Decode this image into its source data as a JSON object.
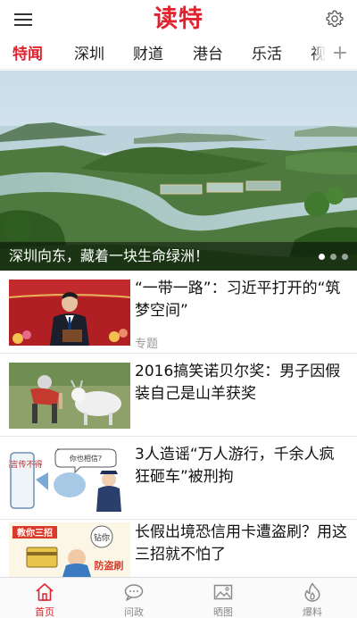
{
  "header": {
    "logo": "读特",
    "menu_icon": "menu-icon",
    "settings_icon": "gear-icon"
  },
  "tabs": [
    {
      "label": "特闻",
      "active": true
    },
    {
      "label": "深圳",
      "active": false
    },
    {
      "label": "财道",
      "active": false
    },
    {
      "label": "港台",
      "active": false
    },
    {
      "label": "乐活",
      "active": false
    },
    {
      "label": "视",
      "active": false
    }
  ],
  "tabs_add_label": "+",
  "hero": {
    "caption": "深圳向东，藏着一块生命绿洲！",
    "slide_count": 3,
    "active_slide": 1
  },
  "news": [
    {
      "title": "“一带一路”：习近平打开的“筑梦空间”",
      "tag": "专题"
    },
    {
      "title": "2016搞笑诺贝尔奖：男子因假装自己是山羊获奖",
      "tag": ""
    },
    {
      "title": "3人造谣“万人游行，千余人疯狂砸车”被刑拘",
      "tag": ""
    },
    {
      "title": "长假出境恐信用卡遭盗刷？用这三招就不怕了",
      "tag": ""
    }
  ],
  "thumb_texts": {
    "news3_bubble": "你也相信?",
    "news3_side": "谣言传不得",
    "news4_top": "教你三招",
    "news4_badge": "防盗刷",
    "news4_bubble": "钻你"
  },
  "bottom_nav": [
    {
      "label": "首页",
      "icon": "home-icon",
      "active": true
    },
    {
      "label": "问政",
      "icon": "chat-bubble-icon",
      "active": false
    },
    {
      "label": "晒图",
      "icon": "image-icon",
      "active": false
    },
    {
      "label": "爆料",
      "icon": "fire-icon",
      "active": false
    }
  ],
  "colors": {
    "accent": "#e0232e",
    "text": "#111111",
    "muted": "#9a9a9a"
  }
}
